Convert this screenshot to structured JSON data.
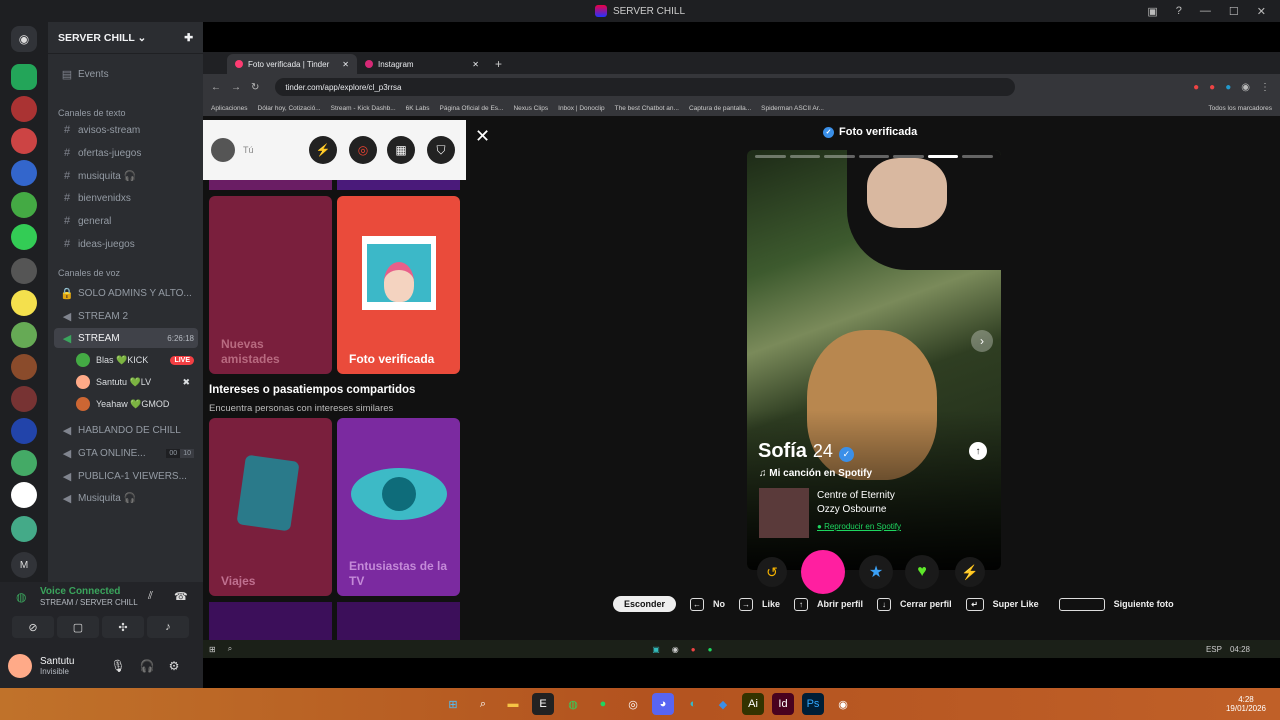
{
  "window": {
    "title": "SERVER CHILL"
  },
  "discord": {
    "server_name": "SERVER CHILL",
    "events": "Events",
    "text_category": "Canales de texto",
    "text_channels": [
      "avisos-stream",
      "ofertas-juegos",
      "musiquita 🎧",
      "bienvenidxs",
      "general",
      "ideas-juegos"
    ],
    "voice_category": "Canales de voz",
    "voice_channels": {
      "admins": "SOLO ADMINS Y ALTO...",
      "stream2": "STREAM 2",
      "stream": "STREAM",
      "stream_time": "6:26:18",
      "hablando": "HABLANDO DE CHILL",
      "gta": "GTA ONLINE...",
      "gta_count": "00",
      "gta_limit": "10",
      "publica": "PUBLICA-1 VIEWERS...",
      "musiquita": "Musiquita 🎧"
    },
    "voice_users": [
      {
        "name": "Blas 💚KICK",
        "badge": "LIVE"
      },
      {
        "name": "Santutu 💚LV",
        "badge": ""
      },
      {
        "name": "Yeahaw 💚GMOD",
        "badge": ""
      }
    ],
    "voice_panel": {
      "status": "Voice Connected",
      "location": "STREAM / SERVER CHILL"
    },
    "user": {
      "name": "Santutu",
      "status": "Invisible"
    }
  },
  "browser": {
    "tabs": [
      {
        "label": "Foto verificada | Tinder"
      },
      {
        "label": "Instagram"
      }
    ],
    "url": "tinder.com/app/explore/cl_p3rrsa",
    "bookmarks": [
      "Aplicaciones",
      "Dólar hoy, Cotizació...",
      "Stream - Kick Dashb...",
      "6K Labs",
      "Página Oficial de Es...",
      "Nexus Clips",
      "Inbox | Donoclip",
      "The best Chatbot an...",
      "Captura de pantalla...",
      "Spiderman ASCII Ar..."
    ],
    "all_bookmarks": "Todos los marcadores"
  },
  "tinder": {
    "user_label": "Tú",
    "cards": {
      "nuevas": "Nuevas amistades",
      "foto": "Foto verificada",
      "viajes": "Viajes",
      "tv": "Entusiastas de la TV"
    },
    "section_title": "Intereses o pasatiempos compartidos",
    "section_sub": "Encuentra personas con intereses similares",
    "header": "Foto verificada",
    "profile": {
      "name": "Sofía",
      "age": "24",
      "anthem_label": "Mi canción en Spotify",
      "song": "Centre of Eternity",
      "artist": "Ozzy Osbourne",
      "play": "Reproducir en Spotify",
      "photo_count": 7,
      "current_photo": 6
    },
    "shortcuts": {
      "hide": "Esconder",
      "no": "No",
      "like": "Like",
      "open": "Abrir perfil",
      "close": "Cerrar perfil",
      "super": "Super Like",
      "next": "Siguiente foto"
    }
  },
  "system": {
    "time": "4:28",
    "date": "19/01/2026",
    "lang": "ESP",
    "mini_time": "04:28"
  }
}
